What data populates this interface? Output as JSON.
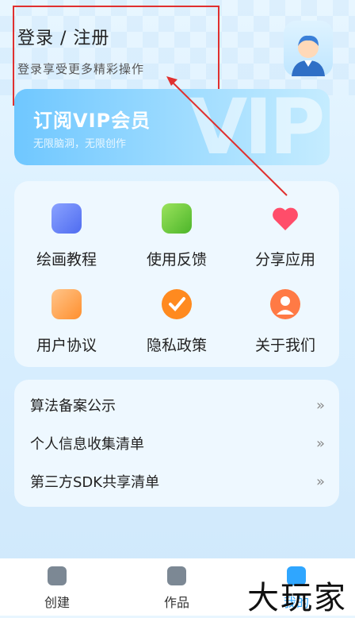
{
  "header": {
    "title": "登录 / 注册",
    "subtitle": "登录享受更多精彩操作"
  },
  "vip": {
    "title": "订阅VIP会员",
    "subtitle": "无限脑洞，无限创作",
    "big_text": "VIP"
  },
  "grid": {
    "items": [
      {
        "label": "绘画教程",
        "icon": "stack-icon",
        "color": "#5b7cff"
      },
      {
        "label": "使用反馈",
        "icon": "feedback-icon",
        "color": "#6ccf3a"
      },
      {
        "label": "分享应用",
        "icon": "heart-icon",
        "color": "#ff4d6a"
      },
      {
        "label": "用户协议",
        "icon": "chat-icon",
        "color": "#ff9a3c"
      },
      {
        "label": "隐私政策",
        "icon": "check-shield-icon",
        "color": "#ff8a1f"
      },
      {
        "label": "关于我们",
        "icon": "person-icon",
        "color": "#ff7a45"
      }
    ]
  },
  "list": {
    "items": [
      {
        "label": "算法备案公示",
        "arrow": "»"
      },
      {
        "label": "个人信息收集清单",
        "arrow": "»"
      },
      {
        "label": "第三方SDK共享清单",
        "arrow": "»"
      }
    ]
  },
  "tabs": [
    {
      "label": "创建",
      "icon": "image-icon"
    },
    {
      "label": "作品",
      "icon": "document-icon"
    },
    {
      "label": "我的",
      "icon": "robot-icon"
    }
  ],
  "watermark": "大玩家",
  "colors": {
    "highlight": "#e0302f",
    "vip_start": "#6fc7ff"
  }
}
